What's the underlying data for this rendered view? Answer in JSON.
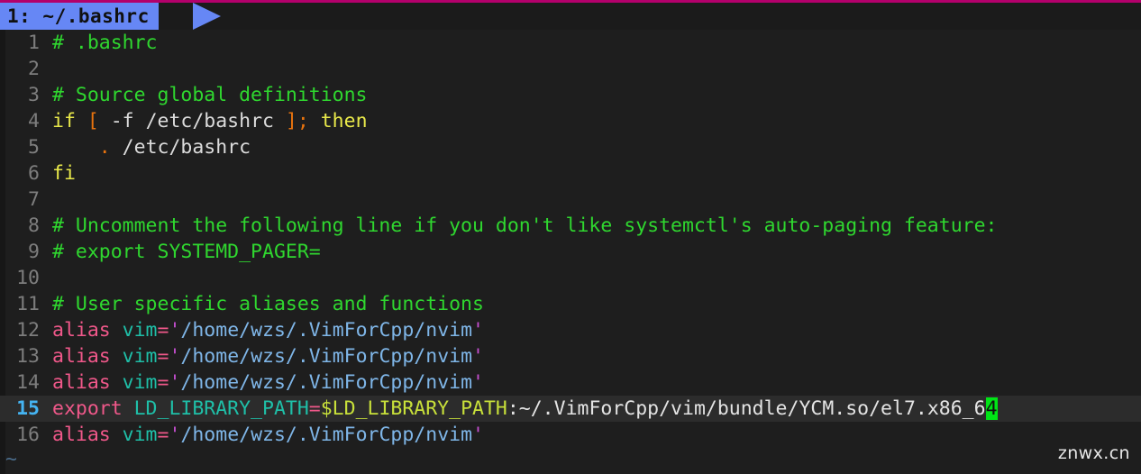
{
  "window": {
    "accent_top_rule": "#b3006b",
    "background": "#1e1e1e"
  },
  "tabline": {
    "tabs": [
      {
        "label": "1: ~/.bashrc",
        "active": true
      }
    ]
  },
  "editor": {
    "filename": "~/.bashrc",
    "cursor_line": 15,
    "cursor_char": "4",
    "empty_marker": "~",
    "lines": [
      {
        "num": "1",
        "tokens": [
          {
            "t": "# .bashrc",
            "c": "c-comment"
          }
        ]
      },
      {
        "num": "2",
        "tokens": []
      },
      {
        "num": "3",
        "tokens": [
          {
            "t": "# Source global definitions",
            "c": "c-comment"
          }
        ]
      },
      {
        "num": "4",
        "tokens": [
          {
            "t": "if ",
            "c": "c-keyword"
          },
          {
            "t": "[",
            "c": "c-bracket"
          },
          {
            "t": " -f /etc/bashrc ",
            "c": "c-plain"
          },
          {
            "t": "];",
            "c": "c-bracket"
          },
          {
            "t": " then",
            "c": "c-keyword"
          }
        ]
      },
      {
        "num": "5",
        "tokens": [
          {
            "t": "    ",
            "c": "c-plain"
          },
          {
            "t": ".",
            "c": "c-bracket"
          },
          {
            "t": " /etc/bashrc",
            "c": "c-plain"
          }
        ]
      },
      {
        "num": "6",
        "tokens": [
          {
            "t": "fi",
            "c": "c-keyword"
          }
        ]
      },
      {
        "num": "7",
        "tokens": []
      },
      {
        "num": "8",
        "tokens": [
          {
            "t": "# Uncomment the following line if you don't like systemctl's auto-paging feature:",
            "c": "c-comment"
          }
        ]
      },
      {
        "num": "9",
        "tokens": [
          {
            "t": "# export SYSTEMD_PAGER=",
            "c": "c-comment"
          }
        ]
      },
      {
        "num": "10",
        "tokens": []
      },
      {
        "num": "11",
        "tokens": [
          {
            "t": "# User specific aliases and functions",
            "c": "c-comment"
          }
        ]
      },
      {
        "num": "12",
        "tokens": [
          {
            "t": "alias ",
            "c": "c-alias"
          },
          {
            "t": "vim",
            "c": "c-ident"
          },
          {
            "t": "=",
            "c": "c-eq"
          },
          {
            "t": "'",
            "c": "c-quote"
          },
          {
            "t": "/home/wzs/.VimForCpp/nvim",
            "c": "c-string"
          },
          {
            "t": "'",
            "c": "c-quote"
          }
        ]
      },
      {
        "num": "13",
        "tokens": [
          {
            "t": "alias ",
            "c": "c-alias"
          },
          {
            "t": "vim",
            "c": "c-ident"
          },
          {
            "t": "=",
            "c": "c-eq"
          },
          {
            "t": "'",
            "c": "c-quote"
          },
          {
            "t": "/home/wzs/.VimForCpp/nvim",
            "c": "c-string"
          },
          {
            "t": "'",
            "c": "c-quote"
          }
        ]
      },
      {
        "num": "14",
        "tokens": [
          {
            "t": "alias ",
            "c": "c-alias"
          },
          {
            "t": "vim",
            "c": "c-ident"
          },
          {
            "t": "=",
            "c": "c-eq"
          },
          {
            "t": "'",
            "c": "c-quote"
          },
          {
            "t": "/home/wzs/.VimForCpp/nvim",
            "c": "c-string"
          },
          {
            "t": "'",
            "c": "c-quote"
          }
        ]
      },
      {
        "num": "15",
        "current": true,
        "tokens": [
          {
            "t": "export ",
            "c": "c-alias"
          },
          {
            "t": "LD_LIBRARY_PATH",
            "c": "c-ident"
          },
          {
            "t": "=",
            "c": "c-eq"
          },
          {
            "t": "$LD_LIBRARY_PATH",
            "c": "c-var"
          },
          {
            "t": ":~/.VimForCpp/vim/bundle/YCM.so/el7.x86_6",
            "c": "c-path"
          },
          {
            "t": "4",
            "c": "cursor"
          }
        ]
      },
      {
        "num": "16",
        "tokens": [
          {
            "t": "alias ",
            "c": "c-alias"
          },
          {
            "t": "vim",
            "c": "c-ident"
          },
          {
            "t": "=",
            "c": "c-eq"
          },
          {
            "t": "'",
            "c": "c-quote"
          },
          {
            "t": "/home/wzs/.VimForCpp/nvim",
            "c": "c-string"
          },
          {
            "t": "'",
            "c": "c-quote"
          }
        ]
      }
    ]
  },
  "watermark": {
    "text": "znwx.cn"
  }
}
